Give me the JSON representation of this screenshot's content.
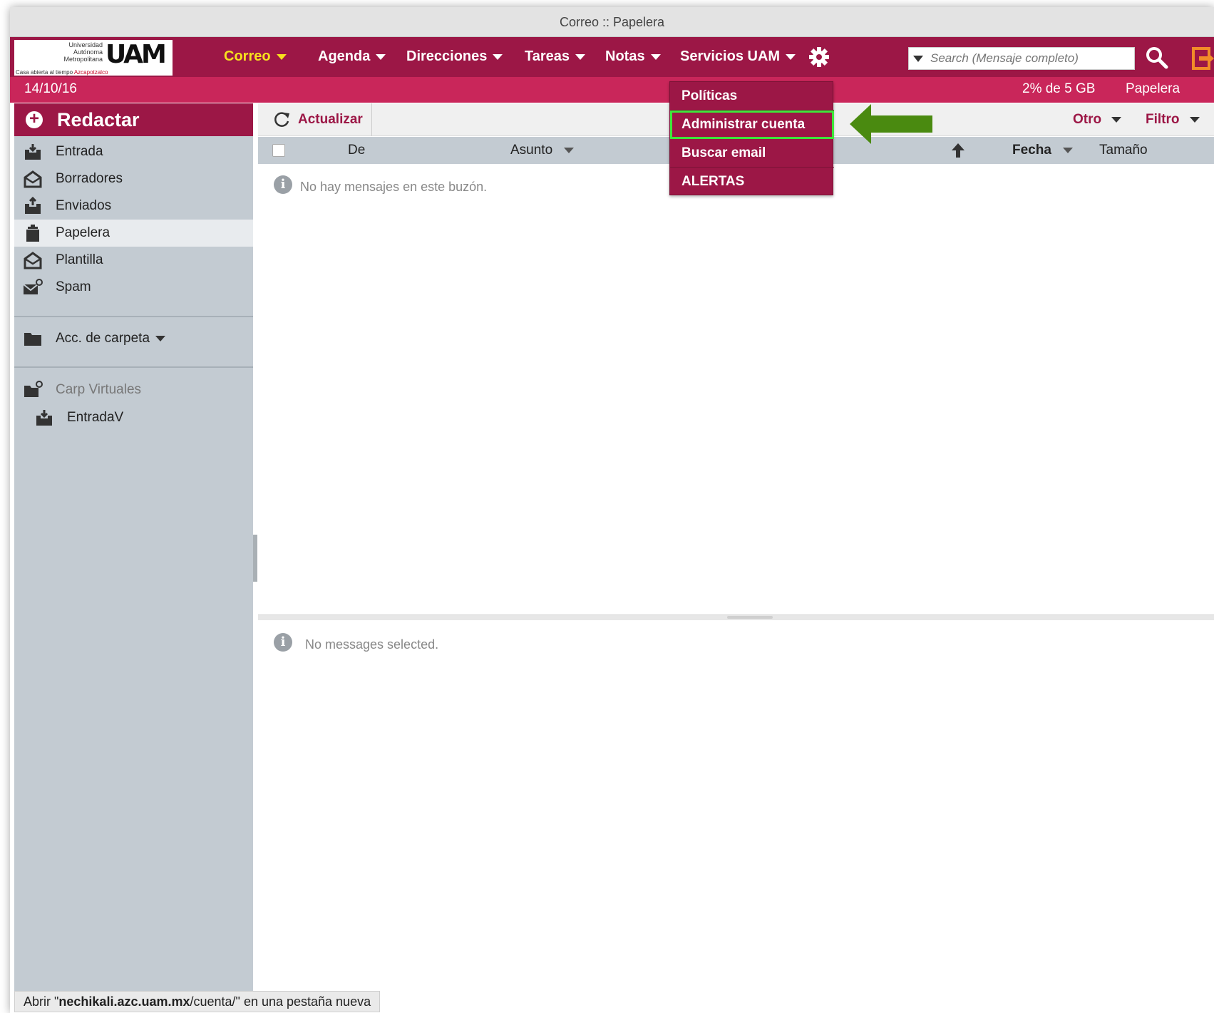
{
  "window": {
    "title": "Correo :: Papelera"
  },
  "logo": {
    "line1": "Universidad",
    "line2": "Autónoma",
    "line3": "Metropolitana",
    "mark": "UAM",
    "tagline": "Casa abierta al tiempo",
    "campus": "Azcapotzalco"
  },
  "nav": [
    {
      "label": "Correo",
      "active": true
    },
    {
      "label": "Agenda"
    },
    {
      "label": "Direcciones"
    },
    {
      "label": "Tareas"
    },
    {
      "label": "Notas"
    },
    {
      "label": "Servicios UAM"
    }
  ],
  "search": {
    "placeholder": "Search (Mensaje completo)"
  },
  "infobar": {
    "date": "14/10/16",
    "quota": "2% de 5 GB",
    "current_folder": "Papelera"
  },
  "sidebar": {
    "compose": "Redactar",
    "folders": [
      {
        "label": "Entrada",
        "icon": "inbox-icon"
      },
      {
        "label": "Borradores",
        "icon": "drafts-icon"
      },
      {
        "label": "Enviados",
        "icon": "sent-icon"
      },
      {
        "label": "Papelera",
        "icon": "trash-icon",
        "selected": true
      },
      {
        "label": "Plantilla",
        "icon": "template-icon"
      },
      {
        "label": "Spam",
        "icon": "spam-icon"
      }
    ],
    "folder_actions": "Acc. de carpeta",
    "virtual_folders": "Carp Virtuales",
    "virtual_inbox": "EntradaV"
  },
  "toolbar": {
    "refresh": "Actualizar",
    "other": "Otro",
    "filter": "Filtro"
  },
  "list": {
    "columns": {
      "from": "De",
      "subject": "Asunto",
      "date": "Fecha",
      "size": "Tamaño"
    },
    "empty_message": "No hay mensajes en este buzón."
  },
  "preview": {
    "empty_message": "No messages selected."
  },
  "dropdown": {
    "items": [
      "Políticas",
      "Administrar cuenta",
      "Buscar email",
      "ALERTAS"
    ],
    "highlighted_index": 1
  },
  "colors": {
    "brand": "#9c1746",
    "brand_light": "#c9265a",
    "active_nav": "#f7e11e",
    "highlight": "#3ee63a",
    "arrow": "#4a8a10"
  },
  "statusbar": {
    "prefix": "Abrir \"",
    "host": "nechikali.azc.uam.mx",
    "path": "/cuenta/",
    "suffix": "\" en una pestaña nueva"
  }
}
